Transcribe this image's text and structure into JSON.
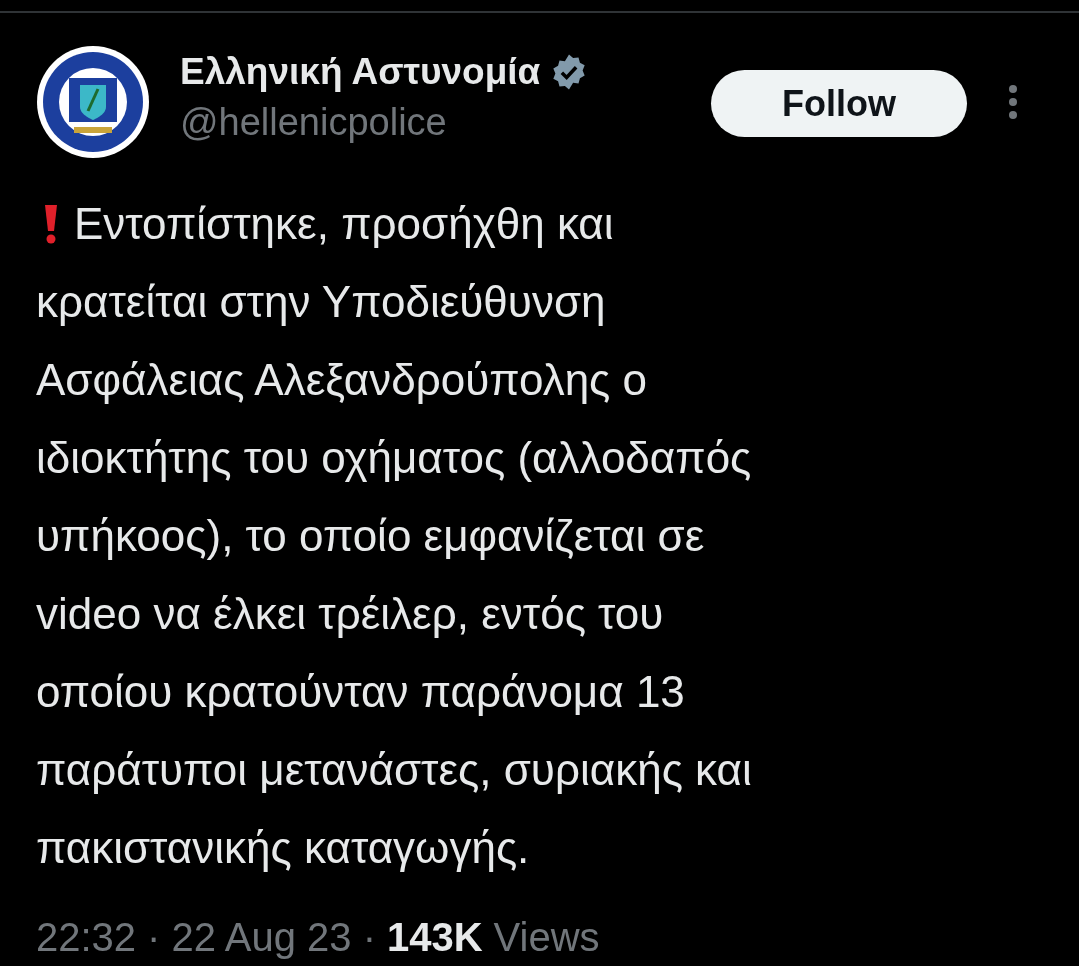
{
  "author": {
    "name": "Ελληνική Αστυνομία",
    "verified": true,
    "handle": "@hellenicpolice"
  },
  "follow_button": "Follow",
  "tweet": {
    "lines": [
      "Εντοπίστηκε, προσήχθη και",
      "κρατείται στην Υποδιεύθυνση",
      "Ασφάλειας Αλεξανδρούπολης ο",
      "ιδιοκτήτης του οχήματος (αλλοδαπός",
      "υπήκοος), το οποίο εμφανίζεται σε",
      "video να έλκει τρέιλερ, εντός του",
      "οποίου κρατούνταν παράνομα 13",
      "παράτυποι μετανάστες, συριακής και",
      "πακιστανικής καταγωγής."
    ]
  },
  "meta": {
    "time": "22:32",
    "separator_1": "·",
    "date": "22 Aug 23",
    "separator_2": "·",
    "views_count": "143K",
    "views_label": "Views"
  }
}
